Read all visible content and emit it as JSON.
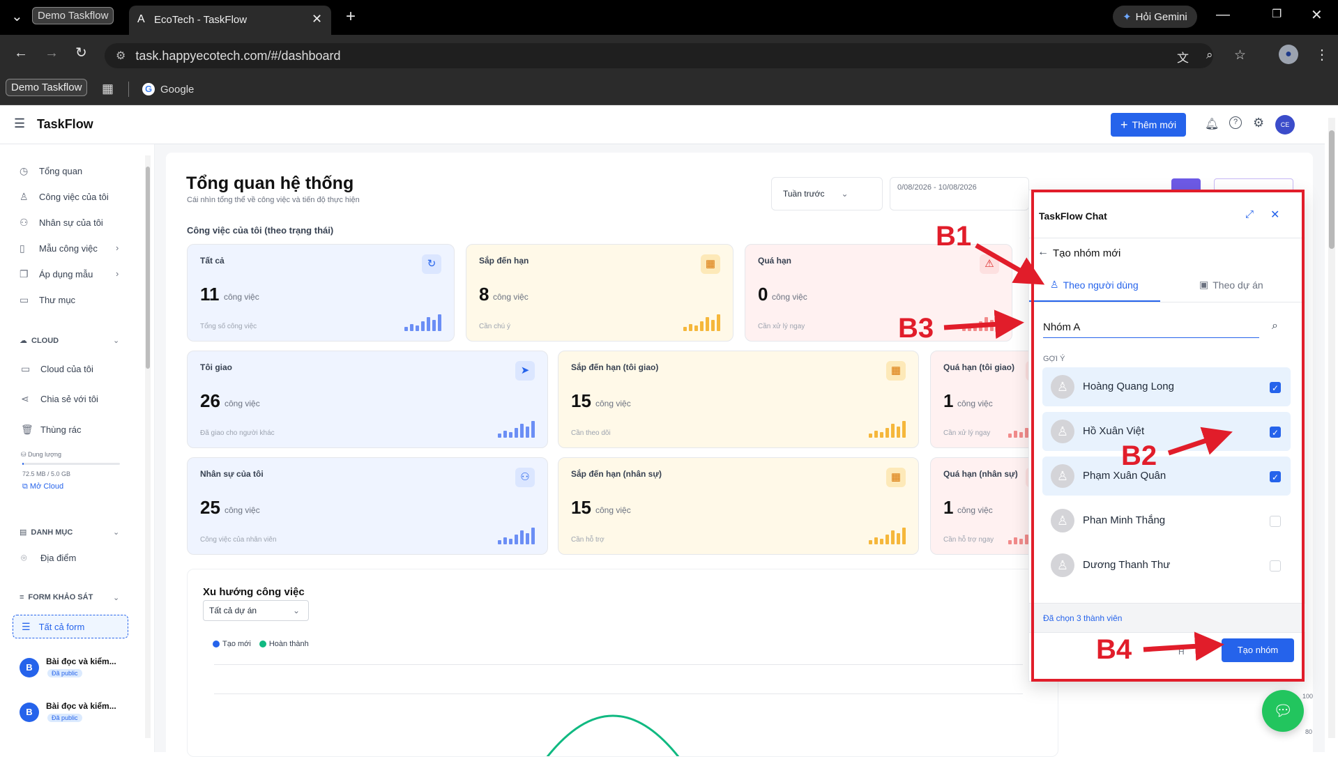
{
  "browser": {
    "tab_inactive": "Demo Taskflow",
    "tab_active": "EcoTech - TaskFlow",
    "gemini": "Hỏi Gemini",
    "url": "task.happyecotech.com/#/dashboard",
    "bookmark_group": "Demo Taskflow",
    "bookmark_google": "Google"
  },
  "topnav": {
    "app_name": "TaskFlow",
    "add_new": "Thêm mới",
    "avatar": "CE"
  },
  "sidebar": {
    "items": [
      {
        "label": "Tổng quan",
        "icon": "clock-icon"
      },
      {
        "label": "Công việc của tôi",
        "icon": "user-icon"
      },
      {
        "label": "Nhân sự của tôi",
        "icon": "users-icon"
      },
      {
        "label": "Mẫu công việc",
        "icon": "file-icon"
      },
      {
        "label": "Áp dụng mẫu",
        "icon": "copy-icon"
      },
      {
        "label": "Thư mục",
        "icon": "folder-icon"
      }
    ],
    "cloud_section": "CLOUD",
    "cloud_items": [
      "Cloud của tôi",
      "Chia sẻ với tôi",
      "Thùng rác"
    ],
    "storage_label": "Dung lượng",
    "storage_value": "72.5 MB / 5.0 GB",
    "storage_fraction": 0.0145,
    "open_cloud": "Mở Cloud",
    "catalog_section": "DANH MỤC",
    "catalog_items": [
      "Địa điểm"
    ],
    "form_section": "FORM KHẢO SÁT",
    "all_forms": "Tất cả form",
    "forms": [
      {
        "letter": "B",
        "title": "Bài đọc và kiểm...",
        "badge": "Đã public"
      },
      {
        "letter": "B",
        "title": "Bài đọc và kiểm...",
        "badge": "Đã public"
      }
    ]
  },
  "dashboard": {
    "title": "Tổng quan hệ thống",
    "subtitle": "Cái nhìn tổng thể về công việc và tiến độ thực hiện",
    "period": "Tuần trước",
    "date_range": "0/08/2026 - 10/08/2026",
    "section_label": "Công việc của tôi (theo trạng thái)",
    "unit": "công việc",
    "row1": [
      {
        "title": "Tất cả",
        "value": "11",
        "sub": "Tổng số công việc",
        "tone": "blue",
        "icon": "refresh-icon"
      },
      {
        "title": "Sắp đến hạn",
        "value": "8",
        "sub": "Cần chú ý",
        "tone": "yel",
        "icon": "calendar-icon"
      },
      {
        "title": "Quá hạn",
        "value": "0",
        "sub": "Cần xử lý ngay",
        "tone": "red",
        "icon": "warning-icon"
      }
    ],
    "row2": [
      {
        "title": "Tôi giao",
        "value": "26",
        "sub": "Đã giao cho người khác",
        "tone": "blue",
        "icon": "send-icon"
      },
      {
        "title": "Sắp đến hạn (tôi giao)",
        "value": "15",
        "sub": "Cần theo dõi",
        "tone": "yel",
        "icon": "calendar-icon"
      },
      {
        "title": "Quá hạn (tôi giao)",
        "value": "1",
        "sub": "Cần xử lý ngay",
        "tone": "red",
        "icon": "warning-icon"
      }
    ],
    "row3": [
      {
        "title": "Nhân sự của tôi",
        "value": "25",
        "sub": "Công việc của nhân viên",
        "tone": "blue",
        "icon": "users-icon"
      },
      {
        "title": "Sắp đến hạn (nhân sự)",
        "value": "15",
        "sub": "Cần hỗ trợ",
        "tone": "yel",
        "icon": "calendar-icon"
      },
      {
        "title": "Quá hạn (nhân sự)",
        "value": "1",
        "sub": "Cần hỗ trợ ngay",
        "tone": "red",
        "icon": "warning-icon"
      }
    ],
    "trend_title": "Xu hướng công việc",
    "project_filter": "Tất cả dự án",
    "legend_created": "Tạo mới",
    "legend_done": "Hoàn thành",
    "y_ticks": [
      "100",
      "80"
    ]
  },
  "chat": {
    "title": "TaskFlow Chat",
    "back_label": "Tạo nhóm mới",
    "tab_users": "Theo người dùng",
    "tab_projects": "Theo dự án",
    "group_name": "Nhóm A",
    "suggest_label": "GỢI Ý",
    "members": [
      {
        "name": "Hoàng Quang Long",
        "checked": true
      },
      {
        "name": "Hồ Xuân Việt",
        "checked": true
      },
      {
        "name": "Phạm Xuân Quân",
        "checked": true
      },
      {
        "name": "Phan Minh Thắng",
        "checked": false
      },
      {
        "name": "Dương Thanh Thư",
        "checked": false
      }
    ],
    "selected_count": "Đã chọn 3 thành viên",
    "create_button": "Tạo nhóm"
  },
  "annotations": [
    "B1",
    "B2",
    "B3",
    "B4"
  ],
  "colors": {
    "primary": "#2563eb",
    "annotation_red": "#e11d2a",
    "chat_fab": "#22c55e",
    "line_done": "#10b981"
  }
}
